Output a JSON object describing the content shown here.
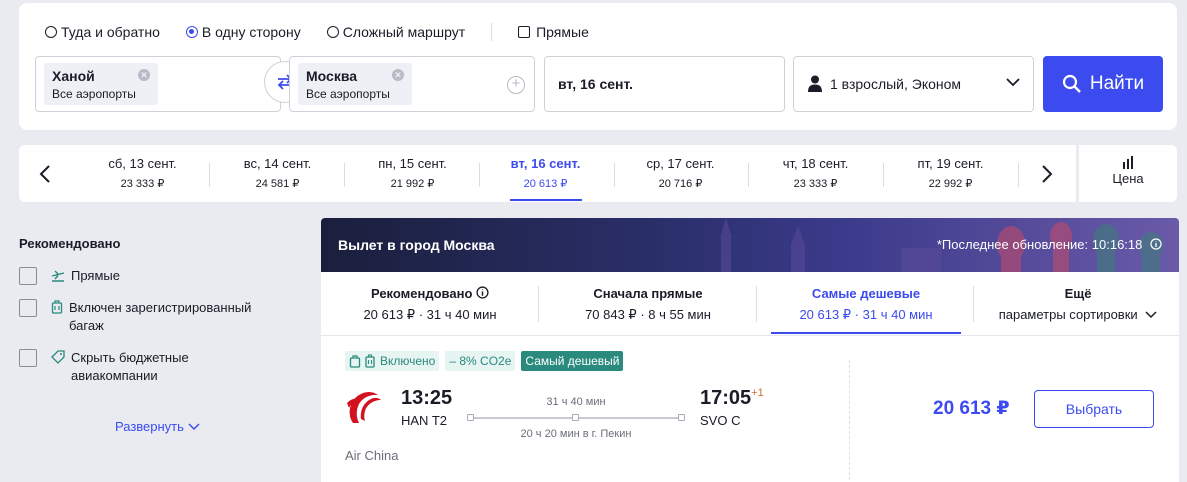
{
  "trip_types": [
    {
      "label": "Туда и обратно",
      "selected": false
    },
    {
      "label": "В одну сторону",
      "selected": true
    },
    {
      "label": "Сложный маршрут",
      "selected": false
    }
  ],
  "direct_check_label": "Прямые",
  "origin": {
    "city": "Ханой",
    "airports": "Все аэропорты"
  },
  "destination": {
    "city": "Москва",
    "airports": "Все аэропорты"
  },
  "date_value": "вт, 16 сент.",
  "passengers_value": "1 взрослый, Эконом",
  "search_button": "Найти",
  "date_strip": [
    {
      "date": "сб, 13 сент.",
      "price": "23 333 ₽"
    },
    {
      "date": "вс, 14 сент.",
      "price": "24 581 ₽"
    },
    {
      "date": "пн, 15 сент.",
      "price": "21 992 ₽"
    },
    {
      "date": "вт, 16 сент.",
      "price": "20 613 ₽",
      "active": true
    },
    {
      "date": "ср, 17 сент.",
      "price": "20 716 ₽"
    },
    {
      "date": "чт, 18 сент.",
      "price": "23 333 ₽"
    },
    {
      "date": "пт, 19 сент.",
      "price": "22 992 ₽"
    }
  ],
  "price_toggle_label": "Цена",
  "filters": {
    "title": "Рекомендовано",
    "items": [
      {
        "label": "Прямые",
        "icon": "plane-icon"
      },
      {
        "label": "Включен зарегистрированный багаж",
        "icon": "luggage-icon"
      },
      {
        "label": "Скрыть бюджетные авиакомпании",
        "icon": "tag-icon"
      }
    ],
    "expand": "Развернуть"
  },
  "banner": {
    "title": "Вылет в город Москва",
    "updated": "*Последнее обновление: 10:16:18"
  },
  "sort_tabs": [
    {
      "title": "Рекомендовано",
      "sub": "20 613 ₽ · 31 ч 40 мин"
    },
    {
      "title": "Сначала прямые",
      "sub": "70 843 ₽ · 8 ч 55 мин"
    },
    {
      "title": "Самые дешевые",
      "sub": "20 613 ₽ · 31 ч 40 мин",
      "active": true
    },
    {
      "title": "Ещё",
      "sub": "параметры сортировки"
    }
  ],
  "ticket": {
    "tag_included": "Включено",
    "tag_co2": "– 8% CO2e",
    "tag_cheapest": "Самый дешевый",
    "dep_time": "13:25",
    "dep_code": "HAN T2",
    "duration": "31 ч 40 мин",
    "layover": "20 ч 20 мин в г. Пекин",
    "arr_time": "17:05",
    "arr_plus": "+1",
    "arr_code": "SVO C",
    "airline": "Air China",
    "price": "20 613 ₽",
    "select_button": "Выбрать"
  },
  "colors": {
    "accent": "#3c4bf0",
    "teal": "#2a8a7e",
    "airline_red": "#d3121f"
  }
}
